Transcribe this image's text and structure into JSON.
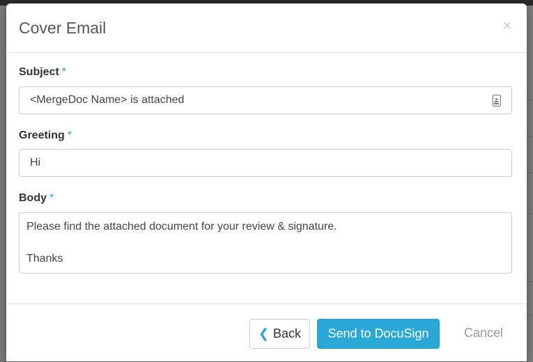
{
  "modal": {
    "title": "Cover Email",
    "close_symbol": "×"
  },
  "form": {
    "subject": {
      "label": "Subject",
      "required_marker": "*",
      "value": "<MergeDoc Name> is attached",
      "icon": "merge-field-icon"
    },
    "greeting": {
      "label": "Greeting",
      "required_marker": "*",
      "value": "Hi"
    },
    "body": {
      "label": "Body",
      "required_marker": "*",
      "lines": [
        "Please find the attached document for your review & signature.",
        "",
        "Thanks"
      ]
    }
  },
  "footer": {
    "back_label": "Back",
    "back_icon": "chevron-left-icon",
    "send_label": "Send to DocuSign",
    "cancel_label": "Cancel"
  },
  "colors": {
    "accent": "#29a8d8",
    "required": "#2a9fd6"
  }
}
